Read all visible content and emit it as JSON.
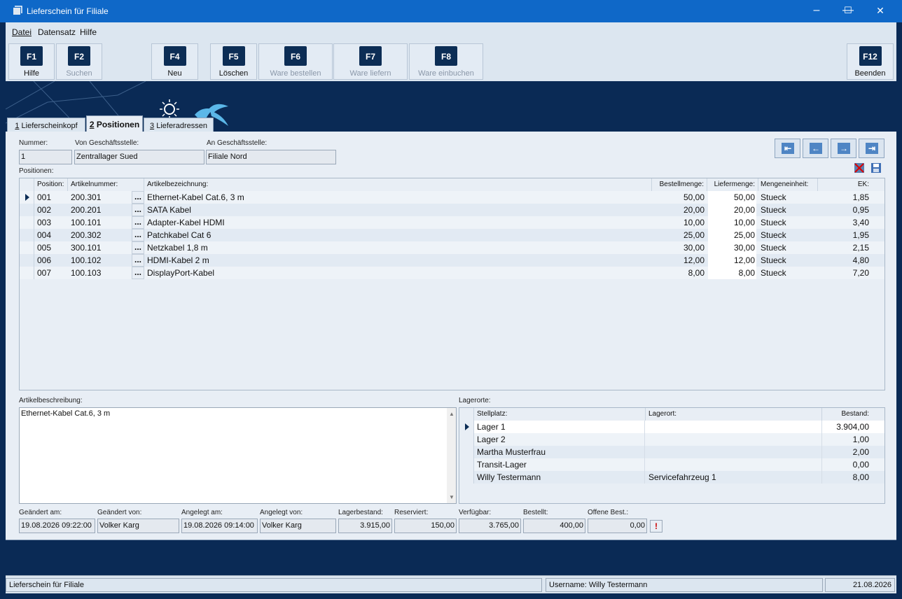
{
  "window": {
    "title": "Lieferschein für Filiale",
    "minimize": "—",
    "maximize": "☐",
    "close": "✕"
  },
  "menu": [
    "Datei",
    "Datensatz",
    "Hilfe"
  ],
  "toolbar": [
    {
      "key": "F1",
      "label": "Hilfe",
      "enabled": true
    },
    {
      "key": "F2",
      "label": "Suchen",
      "enabled": false
    },
    {
      "key": "F4",
      "label": "Neu",
      "enabled": true
    },
    {
      "key": "F5",
      "label": "Löschen",
      "enabled": true
    },
    {
      "key": "F6",
      "label": "Ware bestellen",
      "enabled": false
    },
    {
      "key": "F7",
      "label": "Ware liefern",
      "enabled": false
    },
    {
      "key": "F8",
      "label": "Ware einbuchen",
      "enabled": false
    },
    {
      "key": "F12",
      "label": "Beenden",
      "enabled": true
    }
  ],
  "tabs": [
    {
      "num": "1",
      "label": "Lieferscheinkopf"
    },
    {
      "num": "2",
      "label": "Positionen"
    },
    {
      "num": "3",
      "label": "Lieferadressen"
    }
  ],
  "header": {
    "nummer_label": "Nummer:",
    "nummer": "1",
    "von_label": "Von Geschäftsstelle:",
    "von": "Zentrallager Sued",
    "an_label": "An Geschäftsstelle:",
    "an": "Filiale Nord",
    "positionen_label": "Positionen:"
  },
  "nav_icons": [
    "first-record-icon",
    "previous-record-icon",
    "next-record-icon",
    "last-record-icon"
  ],
  "positions": {
    "columns": [
      "Position:",
      "Artikelnummer:",
      "Artikelbezeichnung:",
      "Bestellmenge:",
      "Liefermenge:",
      "Mengeneinheit:",
      "EK:"
    ],
    "rows": [
      {
        "pos": "001",
        "art": "200.301",
        "bez": "Ethernet-Kabel Cat.6, 3 m",
        "best": "50,00",
        "lief": "50,00",
        "me": "Stueck",
        "ek": "1,85"
      },
      {
        "pos": "002",
        "art": "200.201",
        "bez": "SATA Kabel",
        "best": "20,00",
        "lief": "20,00",
        "me": "Stueck",
        "ek": "0,95"
      },
      {
        "pos": "003",
        "art": "100.101",
        "bez": "Adapter-Kabel HDMI",
        "best": "10,00",
        "lief": "10,00",
        "me": "Stueck",
        "ek": "3,40"
      },
      {
        "pos": "004",
        "art": "200.302",
        "bez": "Patchkabel Cat 6",
        "best": "25,00",
        "lief": "25,00",
        "me": "Stueck",
        "ek": "1,95"
      },
      {
        "pos": "005",
        "art": "300.101",
        "bez": "Netzkabel 1,8 m",
        "best": "30,00",
        "lief": "30,00",
        "me": "Stueck",
        "ek": "2,15"
      },
      {
        "pos": "006",
        "art": "100.102",
        "bez": "HDMI-Kabel 2 m",
        "best": "12,00",
        "lief": "12,00",
        "me": "Stueck",
        "ek": "4,80"
      },
      {
        "pos": "007",
        "art": "100.103",
        "bez": "DisplayPort-Kabel",
        "best": "8,00",
        "lief": "8,00",
        "me": "Stueck",
        "ek": "7,20"
      }
    ],
    "ellipsis": "..."
  },
  "beschreibung": {
    "label": "Artikelbeschreibung:",
    "text": "Ethernet-Kabel Cat.6, 3 m"
  },
  "lagerorte": {
    "label": "Lagerorte:",
    "columns": [
      "Stellplatz:",
      "Lagerort:",
      "Bestand:"
    ],
    "rows": [
      {
        "stell": "Lager 1",
        "ort": "",
        "bestand": "3.904,00"
      },
      {
        "stell": "Lager 2",
        "ort": "",
        "bestand": "1,00"
      },
      {
        "stell": "Martha Musterfrau",
        "ort": "",
        "bestand": "2,00"
      },
      {
        "stell": "Transit-Lager",
        "ort": "",
        "bestand": "0,00"
      },
      {
        "stell": "Willy Testermann",
        "ort": "Servicefahrzeug 1",
        "bestand": "8,00"
      }
    ]
  },
  "footer": {
    "geaendert_am_label": "Geändert am:",
    "geaendert_am": "19.08.2026 09:22:00",
    "geaendert_von_label": "Geändert von:",
    "geaendert_von": "Volker Karg",
    "angelegt_am_label": "Angelegt am:",
    "angelegt_am": "19.08.2026 09:14:00",
    "angelegt_von_label": "Angelegt von:",
    "angelegt_von": "Volker Karg",
    "lagerbestand_label": "Lagerbestand:",
    "lagerbestand": "3.915,00",
    "reserviert_label": "Reserviert:",
    "reserviert": "150,00",
    "verfuegbar_label": "Verfügbar:",
    "verfuegbar": "3.765,00",
    "bestellt_label": "Bestellt:",
    "bestellt": "400,00",
    "offene_label": "Offene Best.:",
    "offene": "0,00",
    "warn": "!"
  },
  "status": {
    "left": "Lieferschein für Filiale",
    "user": "Username: Willy Testermann",
    "date": "21.08.2026"
  },
  "colors": {
    "titlebar": "#0f68c8",
    "banner": "#0a2a55",
    "panel": "#e8eef5"
  }
}
